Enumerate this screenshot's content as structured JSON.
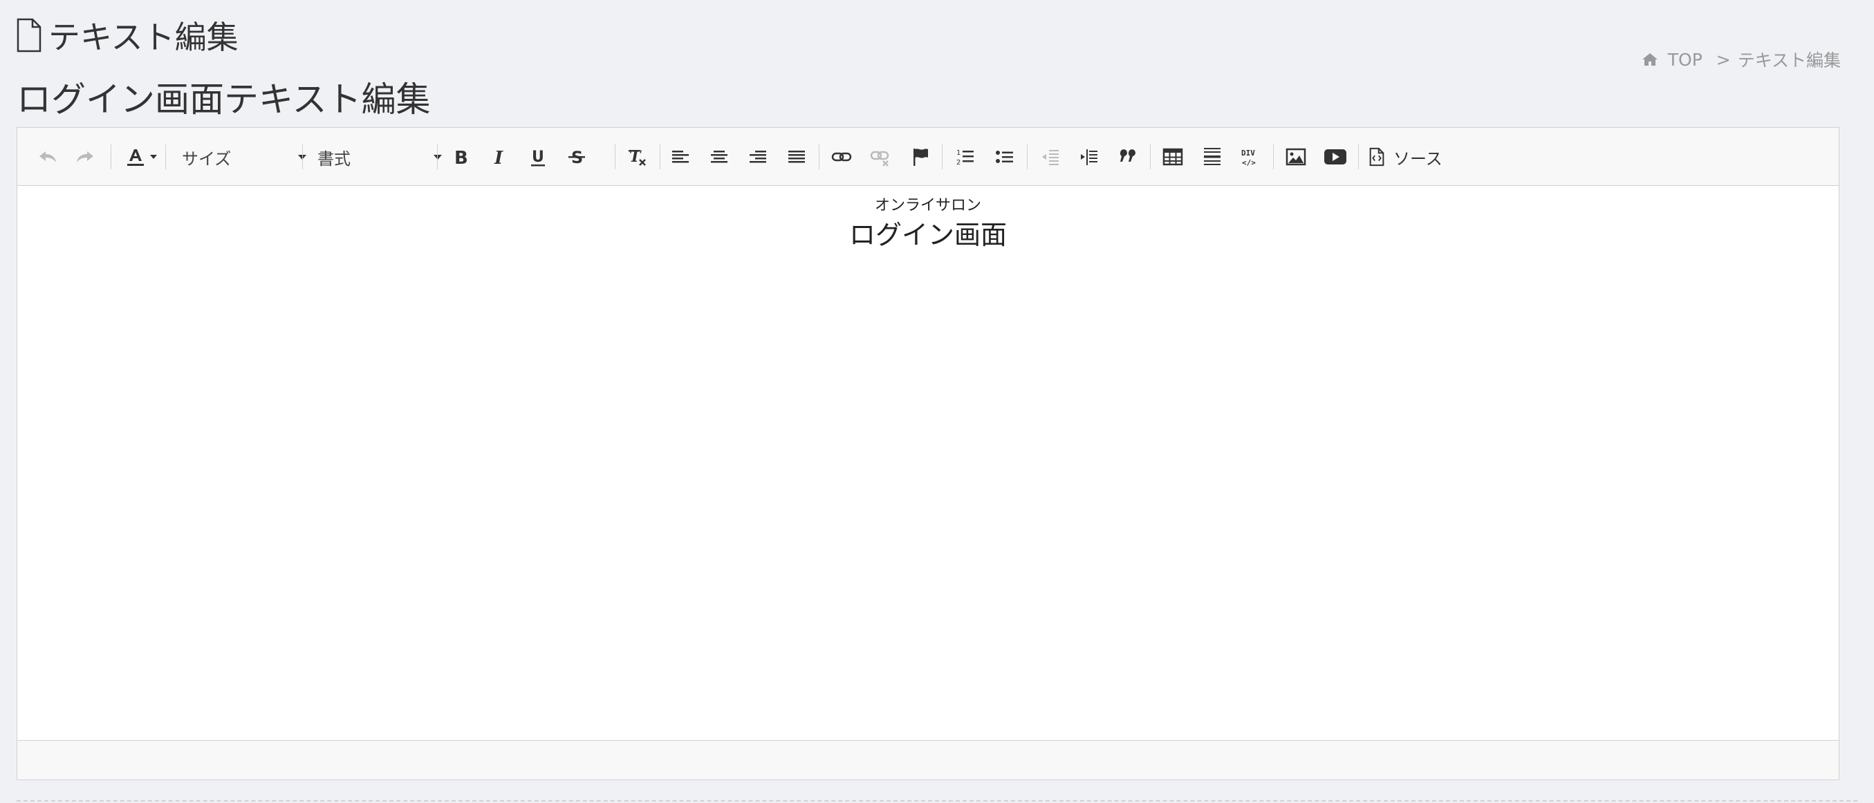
{
  "page": {
    "title": "テキスト編集"
  },
  "breadcrumb": {
    "home": "TOP",
    "separator": ">",
    "current": "テキスト編集"
  },
  "section": {
    "title": "ログイン画面テキスト編集"
  },
  "toolbar": {
    "size_combo": "サイズ",
    "format_combo": "書式",
    "source_label": "ソース",
    "buttons": [
      "undo",
      "redo",
      "text-color",
      "size",
      "format",
      "bold",
      "italic",
      "underline",
      "strikethrough",
      "remove-format",
      "align-left",
      "align-center",
      "align-right",
      "align-justify",
      "link",
      "unlink",
      "anchor",
      "numbered-list",
      "bulleted-list",
      "outdent",
      "indent",
      "blockquote",
      "table",
      "horizontal-line",
      "div-container",
      "image",
      "youtube",
      "source"
    ]
  },
  "content": {
    "subtitle": "オンライサロン",
    "heading": "ログイン画面"
  },
  "colors": {
    "background": "#f0f1f5",
    "toolbar": "#f8f8f8",
    "border": "#d1d1d1",
    "icon": "#333333",
    "disabled_icon": "#bbbbbb"
  }
}
